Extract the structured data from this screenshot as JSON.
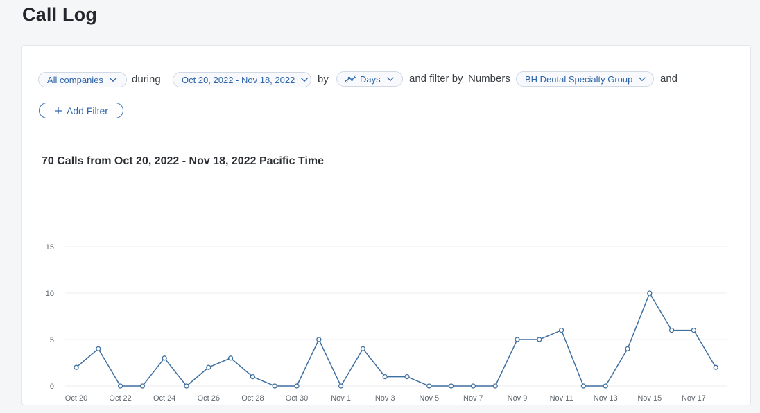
{
  "page": {
    "title": "Call Log"
  },
  "filters": {
    "company_select": "All companies",
    "during_label": "during",
    "date_range_select": "Oct 20, 2022 - Nov 18, 2022",
    "by_label": "by",
    "granularity_select": "Days",
    "filter_by_label": "and filter by",
    "numbers_label": "Numbers",
    "numbers_select": "BH Dental Specialty Group",
    "and_label": "and",
    "add_filter_label": "Add Filter"
  },
  "chart": {
    "title": "70 Calls from Oct 20, 2022 - Nov 18, 2022 Pacific Time",
    "line_color": "#3f6f9f"
  },
  "chart_data": {
    "type": "line",
    "title": "70 Calls from Oct 20, 2022 - Nov 18, 2022 Pacific Time",
    "xlabel": "",
    "ylabel": "",
    "ylim": [
      0,
      15
    ],
    "yticks": [
      0,
      5,
      10,
      15
    ],
    "grid": true,
    "x": [
      "Oct 20",
      "Oct 21",
      "Oct 22",
      "Oct 23",
      "Oct 24",
      "Oct 25",
      "Oct 26",
      "Oct 27",
      "Oct 28",
      "Oct 29",
      "Oct 30",
      "Oct 31",
      "Nov 1",
      "Nov 2",
      "Nov 3",
      "Nov 4",
      "Nov 5",
      "Nov 6",
      "Nov 7",
      "Nov 8",
      "Nov 9",
      "Nov 10",
      "Nov 11",
      "Nov 12",
      "Nov 13",
      "Nov 14",
      "Nov 15",
      "Nov 16",
      "Nov 17",
      "Nov 18"
    ],
    "xtick_labels": [
      "Oct 20",
      "Oct 22",
      "Oct 24",
      "Oct 26",
      "Oct 28",
      "Oct 30",
      "Nov 1",
      "Nov 3",
      "Nov 5",
      "Nov 7",
      "Nov 9",
      "Nov 11",
      "Nov 13",
      "Nov 15",
      "Nov 17"
    ],
    "series": [
      {
        "values": [
          2,
          4,
          0,
          0,
          3,
          0,
          2,
          3,
          1,
          0,
          0,
          5,
          0,
          4,
          1,
          1,
          0,
          0,
          0,
          0,
          5,
          5,
          6,
          0,
          0,
          4,
          10,
          6,
          6,
          2
        ]
      }
    ]
  }
}
